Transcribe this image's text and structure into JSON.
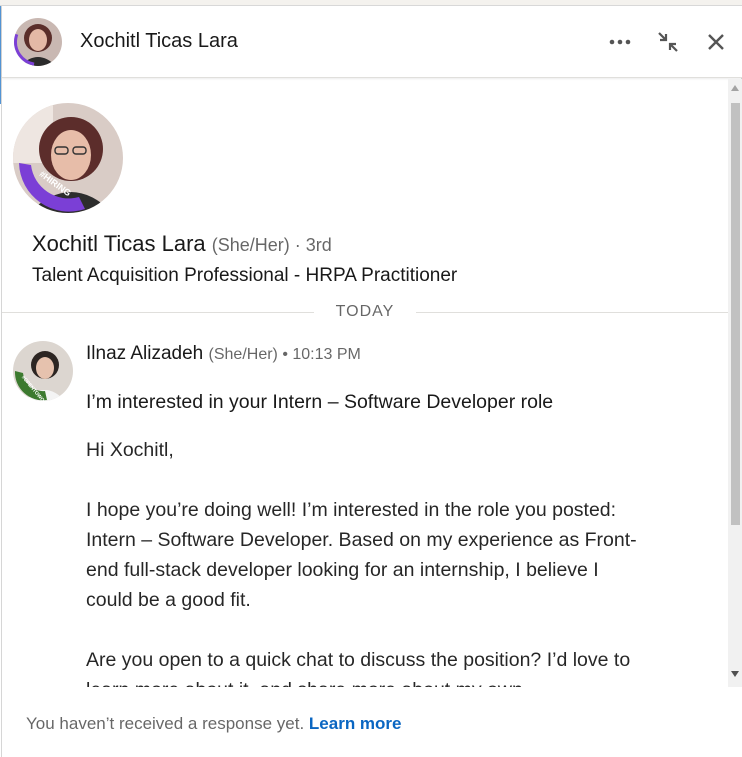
{
  "header": {
    "title": "Xochitl Ticas Lara",
    "more_icon": "ellipsis-icon",
    "minimize_icon": "minimize-arrows-icon",
    "close_icon": "close-icon"
  },
  "profile": {
    "name": "Xochitl Ticas Lara",
    "meta": "(She/Her) · 3rd",
    "headline": "Talent Acquisition Professional - HRPA Practitioner",
    "badge": "#HIRING"
  },
  "divider": {
    "label": "TODAY"
  },
  "message": {
    "sender": "Ilnaz Alizadeh",
    "sender_meta": "(She/Her) • 10:13 PM",
    "badge": "#OPENTOWORK",
    "subject": "I’m interested in your Intern – Software Developer role",
    "paragraphs": [
      "Hi Xochitl,",
      "I hope you’re doing well! I’m interested in the role you posted: Intern – Software Developer. Based on my experience as Front-end full-stack developer looking for an internship, I believe I could be a good fit.",
      "Are you open to a quick chat to discuss the position? I’d love to learn more about it, and share more about my own"
    ]
  },
  "footer": {
    "text": "You haven’t received a response yet.",
    "link": "Learn more"
  },
  "colors": {
    "accent": "#0a66c2",
    "hiring_purple": "#7b3fd6",
    "opentowork_green": "#3c7a2f"
  }
}
